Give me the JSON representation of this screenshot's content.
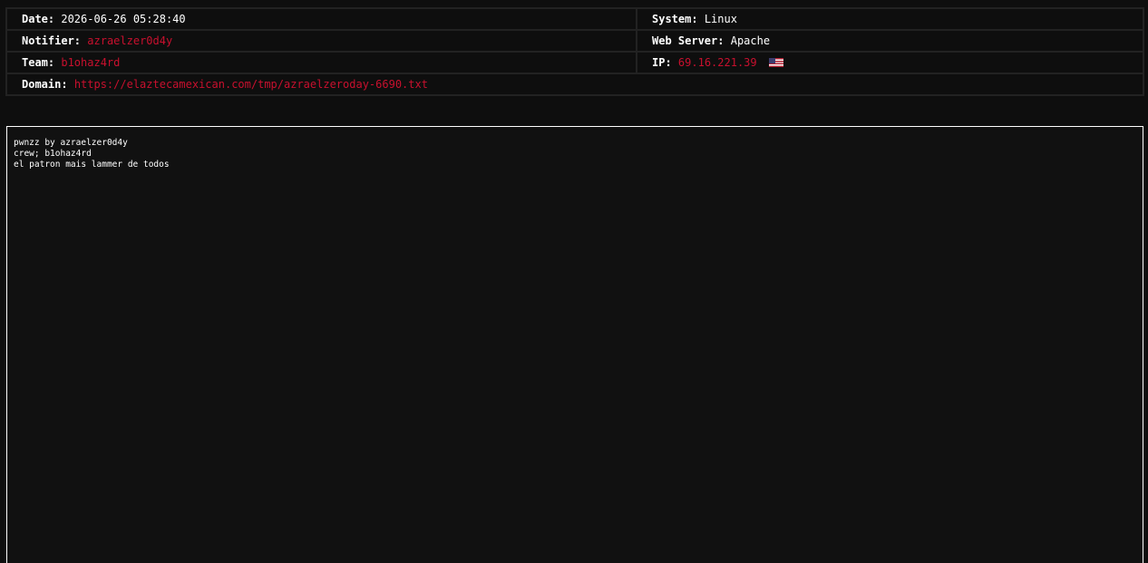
{
  "info": {
    "date": {
      "label": "Date:",
      "value": "2026-06-26 05:28:40"
    },
    "system": {
      "label": "System:",
      "value": "Linux"
    },
    "notifier": {
      "label": "Notifier:",
      "value": "azraelzer0d4y"
    },
    "web_server": {
      "label": "Web Server:",
      "value": "Apache"
    },
    "team": {
      "label": "Team:",
      "value": "b1ohaz4rd"
    },
    "ip": {
      "label": "IP:",
      "value": "69.16.221.39",
      "flag": "us-flag-icon"
    },
    "domain": {
      "label": "Domain:",
      "value": "https://elaztecamexican.com/tmp/azraelzeroday-6690.txt"
    }
  },
  "message": {
    "lines": [
      "pwnzz by azraelzer0d4y",
      "crew; b1ohaz4rd",
      "el patron mais lammer de todos"
    ]
  },
  "colors": {
    "background": "#0e0e0e",
    "border": "#222222",
    "accent_red": "#c8102e",
    "text": "#ffffff"
  }
}
